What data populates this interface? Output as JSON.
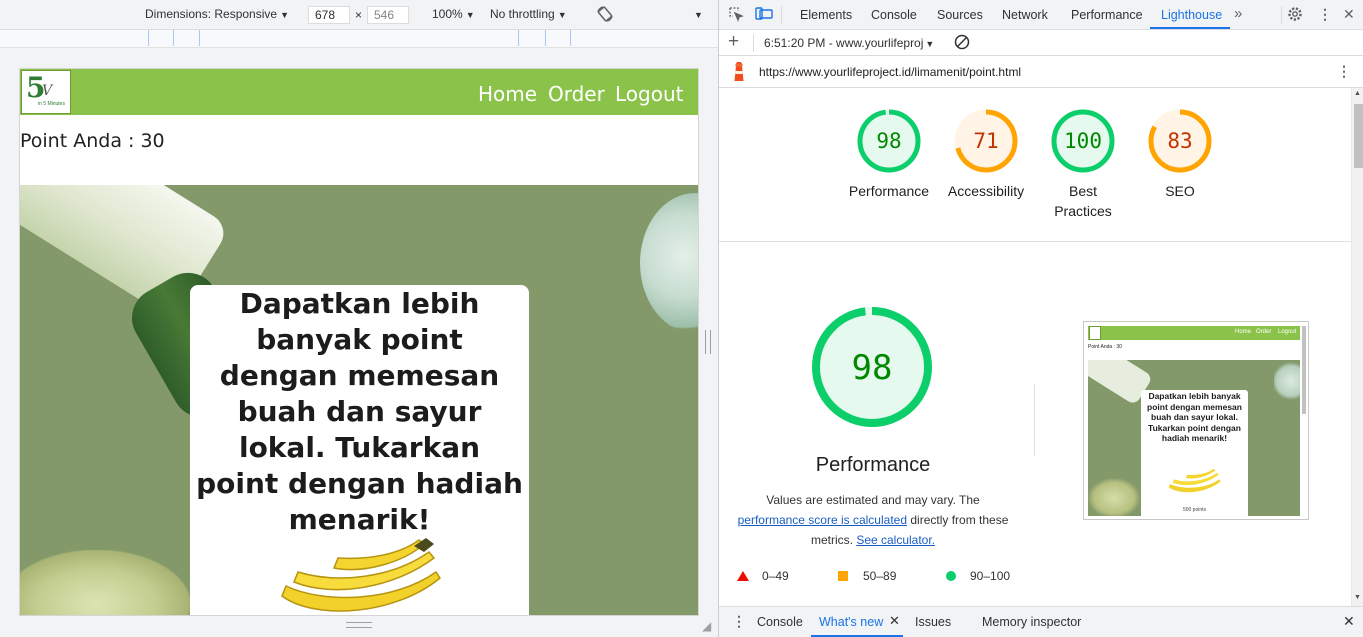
{
  "device_toolbar": {
    "dimensions_label": "Dimensions: Responsive",
    "width_value": "678",
    "times": "×",
    "height_value": "546",
    "zoom": "100%",
    "throttling": "No throttling"
  },
  "site": {
    "nav": {
      "home": "Home",
      "order": "Order",
      "logout": "Logout"
    },
    "logo": {
      "mark": "5",
      "v": "V",
      "sub": "in 5 Minutes"
    },
    "point_text": "Point Anda : 30",
    "promo": "Dapatkan lebih banyak point dengan memesan buah dan sayur lokal. Tukarkan point dengan hadiah menarik!"
  },
  "devtools": {
    "tabs": [
      "Elements",
      "Console",
      "Sources",
      "Network",
      "Performance",
      "Lighthouse"
    ],
    "active_tab": "Lighthouse",
    "report_selector": "6:51:20 PM - www.yourlifeproj",
    "url": "https://www.yourlifeproject.id/limamenit/point.html"
  },
  "scores": [
    {
      "label": "Performance",
      "value": 98,
      "color": "#0cce6b",
      "text_color": "#008800",
      "bg": "#e6f9ee"
    },
    {
      "label": "Accessibility",
      "value": 71,
      "color": "#ffa400",
      "text_color": "#c33300",
      "bg": "#fff4e6"
    },
    {
      "label": "Best Practices",
      "value": 100,
      "color": "#0cce6b",
      "text_color": "#008800",
      "bg": "#e6f9ee"
    },
    {
      "label": "SEO",
      "value": 83,
      "color": "#ffa400",
      "text_color": "#c33300",
      "bg": "#fff4e6"
    }
  ],
  "performance_section": {
    "score": 98,
    "label": "Performance",
    "desc_part1": "Values are estimated and may vary. The",
    "desc_link1": "performance score is calculated",
    "desc_part2": "directly from these metrics.",
    "desc_link2": "See calculator."
  },
  "legend": {
    "fail": "0–49",
    "average": "50–89",
    "pass": "90–100"
  },
  "thumbnail": {
    "nav": {
      "home": "Home",
      "order": "Order",
      "logout": "Logout"
    },
    "point_text": "Point Anda : 30",
    "promo": "Dapatkan lebih banyak point dengan memesan buah dan sayur lokal. Tukarkan point dengan hadiah menarik!",
    "points_caption": "500 points"
  },
  "drawer": {
    "tabs": [
      "Console",
      "What's new",
      "Issues",
      "Memory inspector"
    ],
    "active_tab": "What's new"
  }
}
